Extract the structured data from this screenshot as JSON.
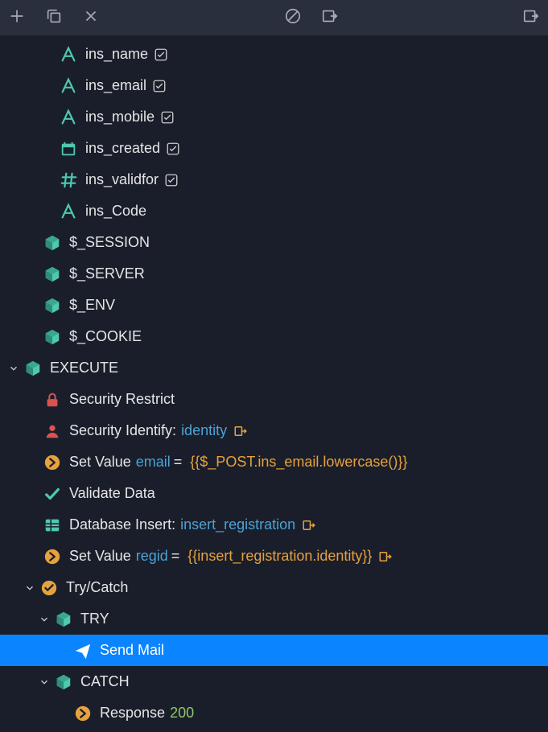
{
  "colors": {
    "teal": "#4ec9b0",
    "orange": "#e6a23c",
    "red": "#d9534f",
    "blue_link": "#4aa3d6",
    "green_code": "#8cc96a",
    "selection": "#0a84ff"
  },
  "fields": [
    {
      "name": "ins_name",
      "icon": "text",
      "checked": true,
      "checkVisible": true
    },
    {
      "name": "ins_email",
      "icon": "text",
      "checked": true,
      "checkVisible": true
    },
    {
      "name": "ins_mobile",
      "icon": "text",
      "checked": true,
      "checkVisible": true
    },
    {
      "name": "ins_created",
      "icon": "date",
      "checked": true,
      "checkVisible": true
    },
    {
      "name": "ins_validfor",
      "icon": "hash",
      "checked": true,
      "checkVisible": true
    },
    {
      "name": "ins_Code",
      "icon": "text",
      "checked": false,
      "checkVisible": false
    }
  ],
  "globals": [
    {
      "name": "$_SESSION"
    },
    {
      "name": "$_SERVER"
    },
    {
      "name": "$_ENV"
    },
    {
      "name": "$_COOKIE"
    }
  ],
  "execute_label": "EXECUTE",
  "steps": {
    "security_restrict": "Security Restrict",
    "security_identify_label": "Security Identify:",
    "security_identify_value": "identity",
    "setvalue1_label": "Set Value",
    "setvalue1_var": "email",
    "setvalue1_expr": "{{$_POST.ins_email.lowercase()}}",
    "validate": "Validate Data",
    "dbinsert_label": "Database Insert:",
    "dbinsert_value": "insert_registration",
    "setvalue2_label": "Set Value",
    "setvalue2_var": "regid",
    "setvalue2_expr": "{{insert_registration.identity}}",
    "trycatch": "Try/Catch",
    "try": "TRY",
    "sendmail": "Send Mail",
    "catch": "CATCH",
    "response_label": "Response",
    "response_code": "200"
  }
}
